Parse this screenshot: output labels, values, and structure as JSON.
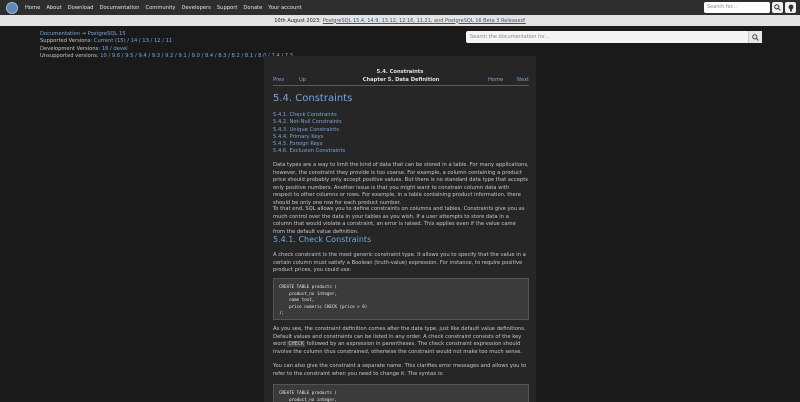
{
  "nav": {
    "items": [
      "Home",
      "About",
      "Download",
      "Documentation",
      "Community",
      "Developers",
      "Support",
      "Donate",
      "Your account"
    ],
    "search_placeholder": "Search for...",
    "search_icon": "search-icon",
    "theme_icon": "lightbulb-icon"
  },
  "banner": {
    "date": "10th August 2023:",
    "link": "PostgreSQL 15.4, 14.9, 13.12, 12.16, 11.21, and PostgreSQL 16 Beta 3 Released!"
  },
  "meta": {
    "breadcrumb_docs": "Documentation",
    "breadcrumb_arrow": "→",
    "breadcrumb_version": "PostgreSQL 15",
    "supported_label": "Supported Versions:",
    "supported_versions": "Current (15) / 14 / 13 / 12 / 11",
    "development_label": "Development Versions:",
    "development_versions": "16 / devel",
    "unsupported_label": "Unsupported versions:",
    "unsupported_versions": "10 / 9.6 / 9.5 / 9.4 / 9.3 / 9.2 / 9.1 / 9.0 / 8.4 / 8.3 / 8.2 / 8.1 / 8.0 / 7.4 / 7.3"
  },
  "docsearch": {
    "placeholder": "Search the documentation for..."
  },
  "header": {
    "title": "5.4. Constraints",
    "prev": "Prev",
    "up": "Up",
    "chapter": "Chapter 5. Data Definition",
    "home": "Home",
    "next": "Next"
  },
  "content": {
    "title": "5.4. Constraints",
    "toc": [
      "5.4.1. Check Constraints",
      "5.4.2. Not-Null Constraints",
      "5.4.3. Unique Constraints",
      "5.4.4. Primary Keys",
      "5.4.5. Foreign Keys",
      "5.4.6. Exclusion Constraints"
    ],
    "para1": "Data types are a way to limit the kind of data that can be stored in a table. For many applications, however, the constraint they provide is too coarse. For example, a column containing a product price should probably only accept positive values. But there is no standard data type that accepts only positive numbers. Another issue is that you might want to constrain column data with respect to other columns or rows. For example, in a table containing product information, there should be only one row for each product number.",
    "para2": "To that end, SQL allows you to define constraints on columns and tables. Constraints give you as much control over the data in your tables as you wish. If a user attempts to store data in a column that would violate a constraint, an error is raised. This applies even if the value came from the default value definition.",
    "section_title": "5.4.1. Check Constraints",
    "para3": "A check constraint is the most generic constraint type. It allows you to specify that the value in a certain column must satisfy a Boolean (truth-value) expression. For instance, to require positive product prices, you could use:",
    "code1": "CREATE TABLE products (\n    product_no integer,\n    name text,\n    price numeric CHECK (price > 0)\n);",
    "para4_a": "As you see, the constraint definition comes after the data type, just like default value definitions. Default values and constraints can be listed in any order. A check constraint consists of the key word ",
    "para4_kw": "CHECK",
    "para4_b": " followed by an expression in parentheses. The check constraint expression should involve the column thus constrained, otherwise the constraint would not make too much sense.",
    "para5": "You can also give the constraint a separate name. This clarifies error messages and allows you to refer to the constraint when you need to change it. The syntax is:",
    "code2": "CREATE TABLE products (\n    product_no integer,"
  }
}
